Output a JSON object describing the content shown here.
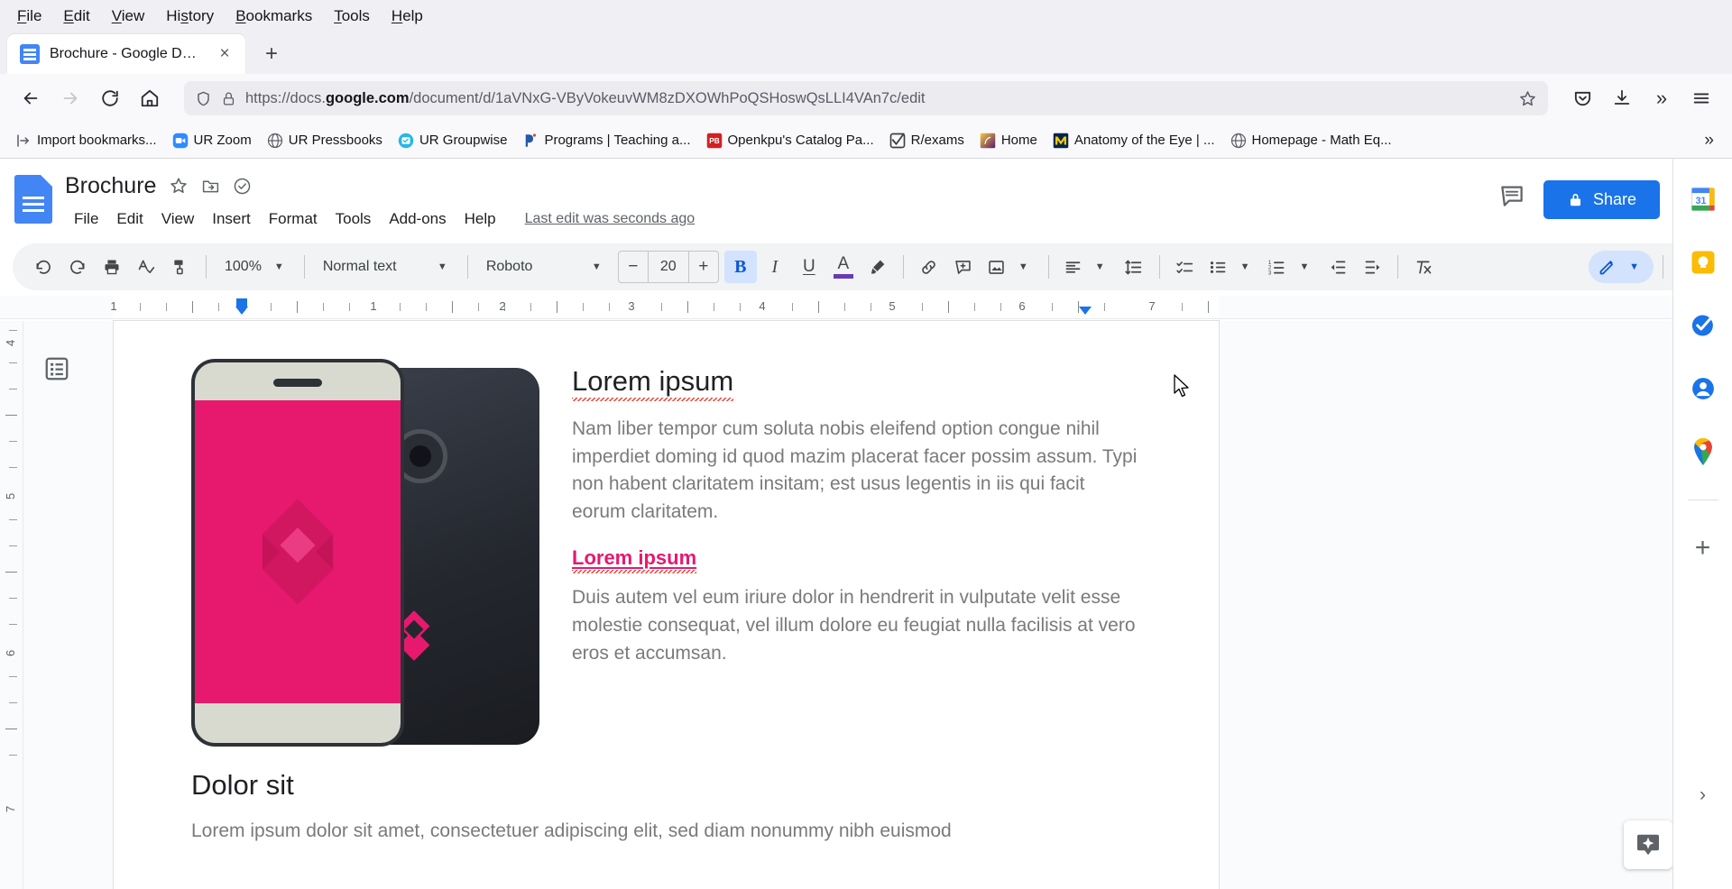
{
  "browser": {
    "menus": [
      {
        "pre": "",
        "acc": "F",
        "post": "ile"
      },
      {
        "pre": "",
        "acc": "E",
        "post": "dit"
      },
      {
        "pre": "",
        "acc": "V",
        "post": "iew"
      },
      {
        "pre": "Hi",
        "acc": "s",
        "post": "tory"
      },
      {
        "pre": "",
        "acc": "B",
        "post": "ookmarks"
      },
      {
        "pre": "",
        "acc": "T",
        "post": "ools"
      },
      {
        "pre": "",
        "acc": "H",
        "post": "elp"
      }
    ],
    "tab": {
      "title": "Brochure - Google Docs",
      "close": "×",
      "favicon": "google-docs-favicon"
    },
    "newtab_label": "+",
    "url": {
      "scheme": "https://docs.",
      "domain": "google.com",
      "path": "/document/d/1aVNxG-VByVokeuvWM8zDXOWhPoQSHoswQsLLI4VAn7c/edit"
    },
    "bookmarks": [
      {
        "label": "Import bookmarks...",
        "icon": "import-icon"
      },
      {
        "label": "UR Zoom",
        "icon": "zoom-icon"
      },
      {
        "label": "UR Pressbooks",
        "icon": "globe-icon"
      },
      {
        "label": "UR Groupwise",
        "icon": "groupwise-icon"
      },
      {
        "label": "Programs | Teaching a...",
        "icon": "programs-icon"
      },
      {
        "label": "Openkpu's Catalog Pa...",
        "icon": "pb-icon"
      },
      {
        "label": "R/exams",
        "icon": "checkbox-icon"
      },
      {
        "label": "Home",
        "icon": "home-site-icon"
      },
      {
        "label": "Anatomy of the Eye | ...",
        "icon": "michigan-icon"
      },
      {
        "label": "Homepage - Math Eq...",
        "icon": "globe-icon"
      }
    ],
    "bookmarks_overflow": "»",
    "nav": {
      "back": "back-arrow",
      "forward": "forward-arrow",
      "reload": "reload-icon",
      "home": "home-icon",
      "bookmark_star": "star-icon",
      "pocket": "pocket-icon",
      "downloads": "download-icon",
      "overflow": "»",
      "menu": "hamburger-menu"
    }
  },
  "docs": {
    "title": "Brochure",
    "title_icons": [
      "star-icon",
      "move-to-folder-icon",
      "cloud-saved-icon"
    ],
    "menus": [
      "File",
      "Edit",
      "View",
      "Insert",
      "Format",
      "Tools",
      "Add-ons",
      "Help"
    ],
    "last_edit": "Last edit was seconds ago",
    "share_label": "Share",
    "comment_history_icon": "comment-history-icon",
    "toolbar": {
      "zoom": "100%",
      "style": "Normal text",
      "font": "Roboto",
      "font_size": "20",
      "decrease": "−",
      "increase": "+",
      "bold": "B",
      "italic": "I",
      "underline": "U",
      "text_color_letter": "A",
      "text_color_hex": "#673ab7",
      "bold_active": true,
      "edit_mode": "editing-pencil"
    },
    "ruler": {
      "numbers": [
        "1",
        "1",
        "2",
        "3",
        "4",
        "5",
        "6",
        "7"
      ],
      "vertical_numbers": [
        "4",
        "5",
        "6",
        "7"
      ]
    }
  },
  "document": {
    "heading1": "Lorem ipsum",
    "paragraph1": "Nam liber tempor cum soluta nobis eleifend option congue nihil imperdiet doming id quod mazim placerat facer possim assum. Typi non habent claritatem insitam; est usus legentis in iis qui facit eorum claritatem.",
    "subheading": "Lorem ipsum",
    "paragraph2": "Duis autem vel eum iriure dolor in hendrerit in vulputate velit esse molestie consequat, vel illum dolore eu feugiat nulla facilisis at vero eros et accumsan.",
    "heading2": "Dolor sit",
    "paragraph3": "Lorem ipsum dolor sit amet, consectetuer adipiscing elit, sed diam nonummy nibh euismod",
    "colors": {
      "accent_pink": "#e6196e",
      "body_gray": "#7a7a7a",
      "heading": "#202124"
    }
  },
  "sidepanel": {
    "items": [
      {
        "name": "google-calendar-icon"
      },
      {
        "name": "google-keep-icon"
      },
      {
        "name": "google-tasks-icon"
      },
      {
        "name": "google-contacts-icon"
      },
      {
        "name": "google-maps-icon"
      }
    ],
    "add_label": "+",
    "expand_chevron": "›"
  },
  "explore_button": "explore-sparkle-icon"
}
